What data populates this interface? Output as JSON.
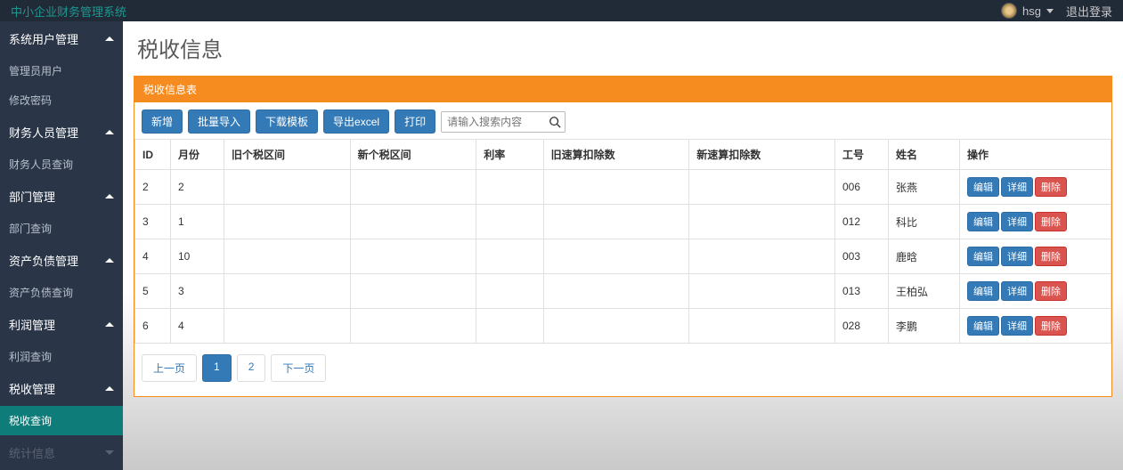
{
  "brand": "中小企业财务管理系统",
  "user": {
    "name": "hsg",
    "logout": "退出登录"
  },
  "sidebar": {
    "groups": [
      {
        "label": "系统用户管理",
        "open": true,
        "items": [
          {
            "label": "管理员用户"
          },
          {
            "label": "修改密码"
          }
        ]
      },
      {
        "label": "财务人员管理",
        "open": true,
        "items": [
          {
            "label": "财务人员查询"
          }
        ]
      },
      {
        "label": "部门管理",
        "open": true,
        "items": [
          {
            "label": "部门查询"
          }
        ]
      },
      {
        "label": "资产负债管理",
        "open": true,
        "items": [
          {
            "label": "资产负债查询"
          }
        ]
      },
      {
        "label": "利润管理",
        "open": true,
        "items": [
          {
            "label": "利润查询"
          }
        ]
      },
      {
        "label": "税收管理",
        "open": true,
        "items": [
          {
            "label": "税收查询",
            "active": true
          }
        ]
      },
      {
        "label": "统计信息",
        "open": false,
        "disabled": true,
        "items": []
      }
    ]
  },
  "page": {
    "title": "税收信息",
    "panel_title": "税收信息表"
  },
  "toolbar": {
    "add": "新增",
    "bulk_import": "批量导入",
    "download_tpl": "下载模板",
    "export_excel": "导出excel",
    "print": "打印",
    "search_placeholder": "请输入搜索内容"
  },
  "table": {
    "columns": [
      "ID",
      "月份",
      "旧个税区间",
      "新个税区间",
      "利率",
      "旧速算扣除数",
      "新速算扣除数",
      "工号",
      "姓名",
      "操作"
    ],
    "rows": [
      {
        "id": "2",
        "month": "2",
        "old_bracket": "",
        "new_bracket": "",
        "rate": "",
        "old_deduct": "",
        "new_deduct": "",
        "empno": "006",
        "name": "张燕"
      },
      {
        "id": "3",
        "month": "1",
        "old_bracket": "",
        "new_bracket": "",
        "rate": "",
        "old_deduct": "",
        "new_deduct": "",
        "empno": "012",
        "name": "科比"
      },
      {
        "id": "4",
        "month": "10",
        "old_bracket": "",
        "new_bracket": "",
        "rate": "",
        "old_deduct": "",
        "new_deduct": "",
        "empno": "003",
        "name": "鹿晗"
      },
      {
        "id": "5",
        "month": "3",
        "old_bracket": "",
        "new_bracket": "",
        "rate": "",
        "old_deduct": "",
        "new_deduct": "",
        "empno": "013",
        "name": "王柏弘"
      },
      {
        "id": "6",
        "month": "4",
        "old_bracket": "",
        "new_bracket": "",
        "rate": "",
        "old_deduct": "",
        "new_deduct": "",
        "empno": "028",
        "name": "李鹏"
      }
    ],
    "actions": {
      "edit": "编辑",
      "detail": "详细",
      "delete": "删除"
    }
  },
  "pagination": {
    "prev": "上一页",
    "pages": [
      "1",
      "2"
    ],
    "next": "下一页",
    "active": 1
  }
}
